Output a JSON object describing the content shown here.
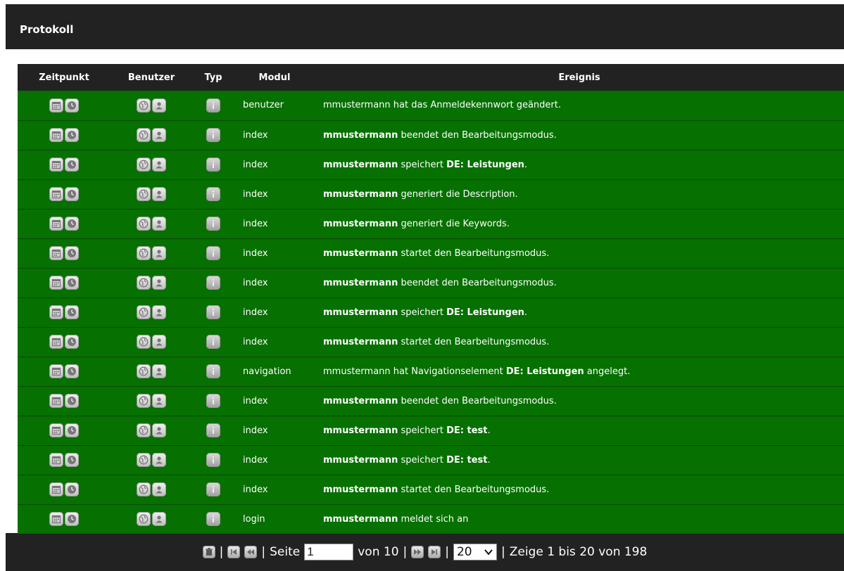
{
  "panel": {
    "title": "Protokoll"
  },
  "table": {
    "headers": {
      "time": "Zeitpunkt",
      "user": "Benutzer",
      "type": "Typ",
      "module": "Modul",
      "event": "Ereignis"
    },
    "rows": [
      {
        "module": "benutzer",
        "event": [
          {
            "text": "mmustermann hat das Anmeldekennwort geändert.",
            "bold": false
          }
        ]
      },
      {
        "module": "index",
        "event": [
          {
            "text": "mmustermann",
            "bold": true
          },
          {
            "text": " beendet den Bearbeitungsmodus.",
            "bold": false
          }
        ]
      },
      {
        "module": "index",
        "event": [
          {
            "text": "mmustermann",
            "bold": true
          },
          {
            "text": " speichert ",
            "bold": false
          },
          {
            "text": "DE: Leistungen",
            "bold": true
          },
          {
            "text": ".",
            "bold": false
          }
        ]
      },
      {
        "module": "index",
        "event": [
          {
            "text": "mmustermann",
            "bold": true
          },
          {
            "text": " generiert die Description.",
            "bold": false
          }
        ]
      },
      {
        "module": "index",
        "event": [
          {
            "text": "mmustermann",
            "bold": true
          },
          {
            "text": " generiert die Keywords.",
            "bold": false
          }
        ]
      },
      {
        "module": "index",
        "event": [
          {
            "text": "mmustermann",
            "bold": true
          },
          {
            "text": " startet den Bearbeitungsmodus.",
            "bold": false
          }
        ]
      },
      {
        "module": "index",
        "event": [
          {
            "text": "mmustermann",
            "bold": true
          },
          {
            "text": " beendet den Bearbeitungsmodus.",
            "bold": false
          }
        ]
      },
      {
        "module": "index",
        "event": [
          {
            "text": "mmustermann",
            "bold": true
          },
          {
            "text": " speichert ",
            "bold": false
          },
          {
            "text": "DE: Leistungen",
            "bold": true
          },
          {
            "text": ".",
            "bold": false
          }
        ]
      },
      {
        "module": "index",
        "event": [
          {
            "text": "mmustermann",
            "bold": true
          },
          {
            "text": " startet den Bearbeitungsmodus.",
            "bold": false
          }
        ]
      },
      {
        "module": "navigation",
        "event": [
          {
            "text": "mmustermann hat Navigationselement ",
            "bold": false
          },
          {
            "text": "DE: Leistungen",
            "bold": true
          },
          {
            "text": " angelegt.",
            "bold": false
          }
        ]
      },
      {
        "module": "index",
        "event": [
          {
            "text": "mmustermann",
            "bold": true
          },
          {
            "text": " beendet den Bearbeitungsmodus.",
            "bold": false
          }
        ]
      },
      {
        "module": "index",
        "event": [
          {
            "text": "mmustermann",
            "bold": true
          },
          {
            "text": " speichert ",
            "bold": false
          },
          {
            "text": "DE: test",
            "bold": true
          },
          {
            "text": ".",
            "bold": false
          }
        ]
      },
      {
        "module": "index",
        "event": [
          {
            "text": "mmustermann",
            "bold": true
          },
          {
            "text": " speichert ",
            "bold": false
          },
          {
            "text": "DE: test",
            "bold": true
          },
          {
            "text": ".",
            "bold": false
          }
        ]
      },
      {
        "module": "index",
        "event": [
          {
            "text": "mmustermann",
            "bold": true
          },
          {
            "text": " startet den Bearbeitungsmodus.",
            "bold": false
          }
        ]
      },
      {
        "module": "login",
        "event": [
          {
            "text": "mmustermann",
            "bold": true
          },
          {
            "text": " meldet sich an",
            "bold": false
          }
        ]
      }
    ]
  },
  "pagination": {
    "sep": "|",
    "page_label": "Seite",
    "page_value": "1",
    "of_label": "von 10",
    "page_size": "20",
    "summary": "Zeige 1 bis 20 von 198"
  },
  "colors": {
    "row_bg": "#067000",
    "header_bg": "#222222"
  },
  "icons": {
    "row": [
      "calendar-icon",
      "clock-icon",
      "globe-icon",
      "user-icon",
      "info-icon"
    ],
    "footer": [
      "delete-icon",
      "first-page-icon",
      "previous-page-icon",
      "next-page-icon",
      "last-page-icon",
      "chevron-down-icon"
    ]
  }
}
